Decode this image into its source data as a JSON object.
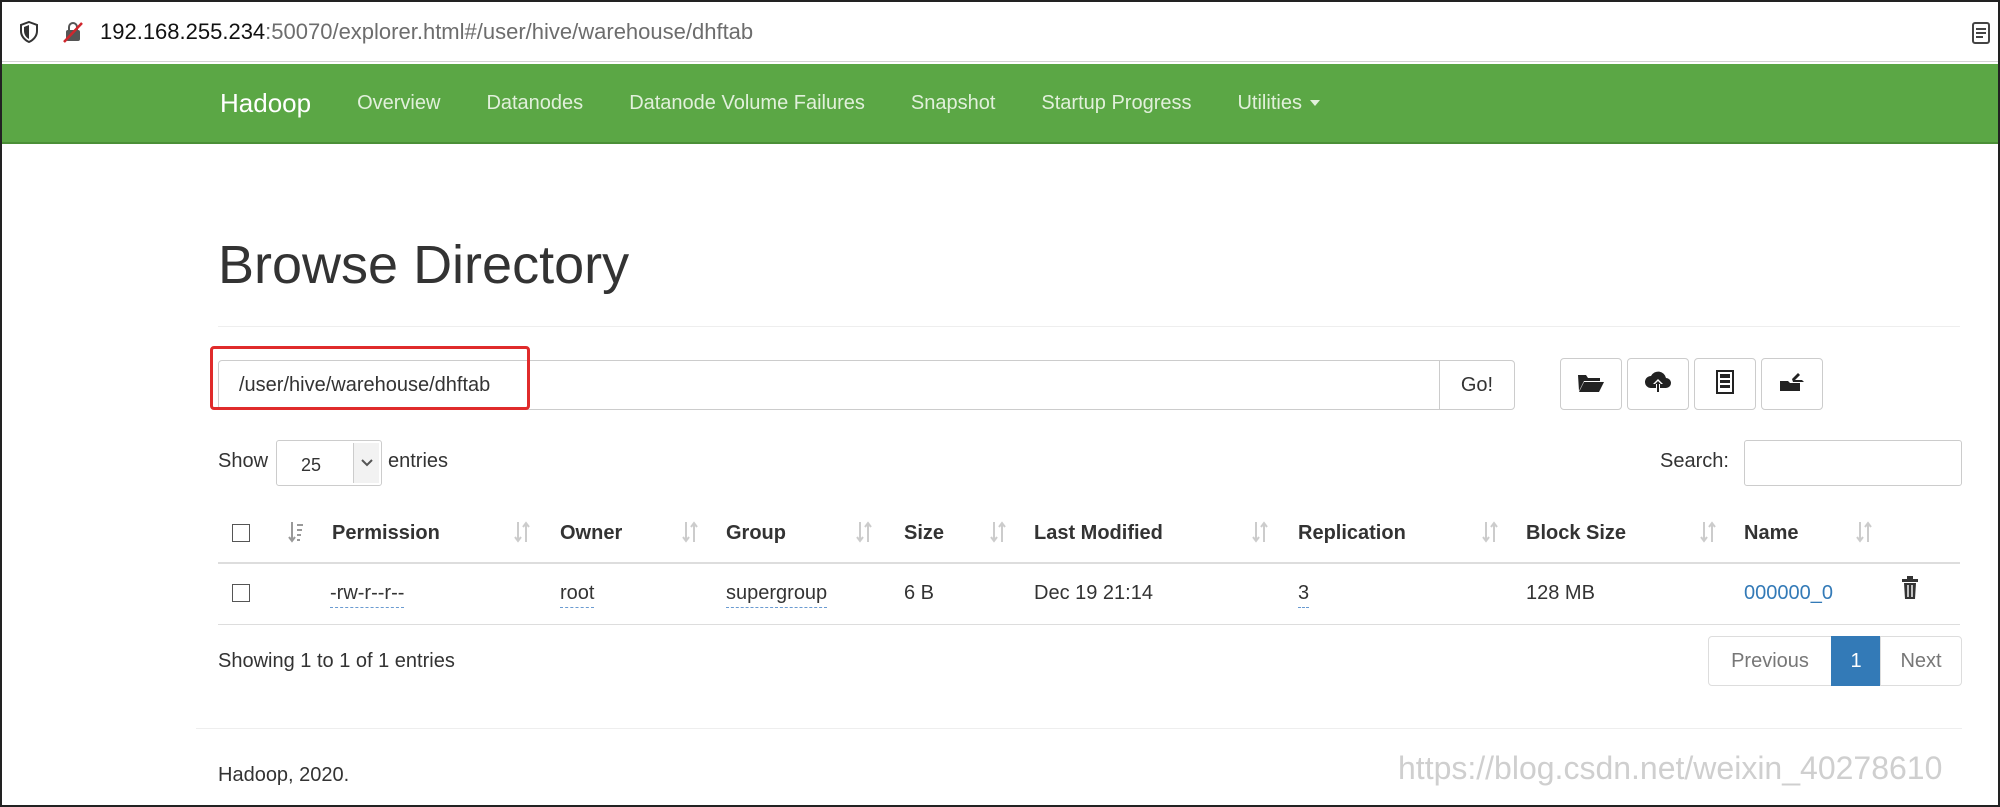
{
  "browser": {
    "url_host": "192.168.255.234",
    "url_rest": ":50070/explorer.html#/user/hive/warehouse/dhftab"
  },
  "navbar": {
    "brand": "Hadoop",
    "items": [
      {
        "label": "Overview"
      },
      {
        "label": "Datanodes"
      },
      {
        "label": "Datanode Volume Failures"
      },
      {
        "label": "Snapshot"
      },
      {
        "label": "Startup Progress"
      },
      {
        "label": "Utilities"
      }
    ]
  },
  "page": {
    "title": "Browse Directory",
    "path_value": "/user/hive/warehouse/dhftab",
    "go_label": "Go!",
    "toolbar_icons": [
      "folder-open-icon",
      "cloud-upload-icon",
      "cut-icon",
      "paste-icon"
    ]
  },
  "table_controls": {
    "show_label": "Show",
    "entries_value": "25",
    "entries_label": "entries",
    "search_label": "Search:"
  },
  "table": {
    "columns": [
      "Permission",
      "Owner",
      "Group",
      "Size",
      "Last Modified",
      "Replication",
      "Block Size",
      "Name"
    ],
    "rows": [
      {
        "permission": "-rw-r--r--",
        "owner": "root",
        "group": "supergroup",
        "size": "6 B",
        "last_modified": "Dec 19 21:14",
        "replication": "3",
        "block_size": "128 MB",
        "name": "000000_0"
      }
    ]
  },
  "pagination": {
    "info": "Showing 1 to 1 of 1 entries",
    "previous": "Previous",
    "current": "1",
    "next": "Next"
  },
  "footer": {
    "text": "Hadoop, 2020."
  },
  "watermark": "https://blog.csdn.net/weixin_40278610",
  "colors": {
    "navbar": "#5ba745",
    "link": "#337ab7",
    "highlight": "#e02b2b"
  }
}
